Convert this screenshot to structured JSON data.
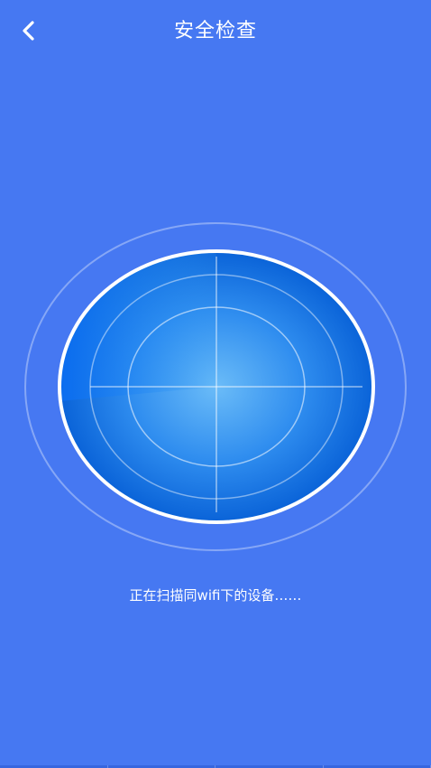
{
  "header": {
    "title": "安全检查",
    "back_icon": "chevron-left-icon"
  },
  "status": {
    "text": "正在扫描同wifi下的设备……"
  },
  "colors": {
    "background": "#4678f2",
    "radar_center": "#5aaef6",
    "radar_edge": "#0a63d8",
    "sweep": "#0d6df0",
    "text": "#ffffff"
  }
}
